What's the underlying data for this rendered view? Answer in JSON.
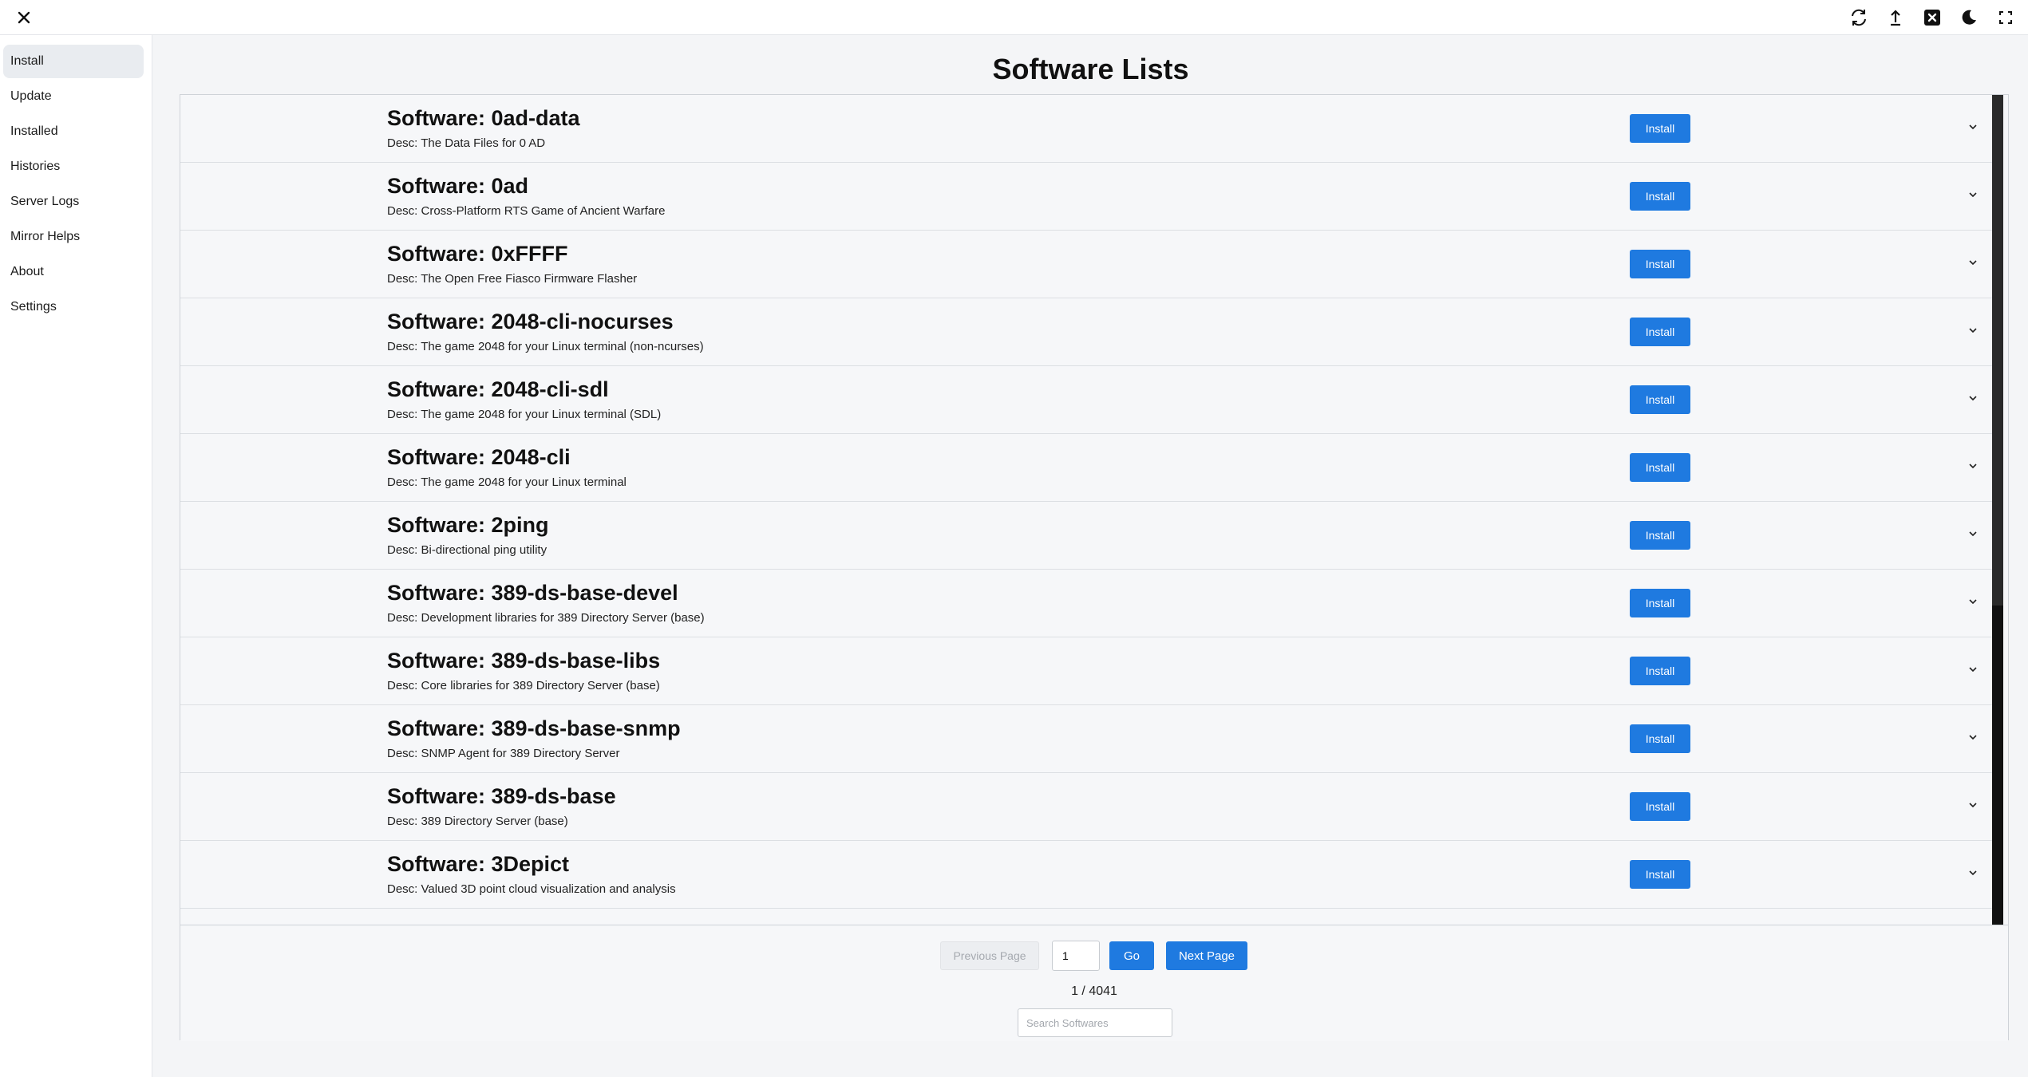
{
  "header": {
    "title": "Software Lists",
    "icons": [
      "close-icon",
      "refresh-icon",
      "upload-icon",
      "close-box-icon",
      "moon-icon",
      "fullscreen-icon"
    ]
  },
  "sidebar": {
    "items": [
      {
        "label": "Install",
        "active": true
      },
      {
        "label": "Update"
      },
      {
        "label": "Installed"
      },
      {
        "label": "Histories"
      },
      {
        "label": "Server Logs"
      },
      {
        "label": "Mirror Helps"
      },
      {
        "label": "About"
      },
      {
        "label": "Settings"
      }
    ]
  },
  "software": [
    {
      "name": "Software: 0ad-data",
      "desc": "Desc: The Data Files for 0 AD",
      "action": "Install"
    },
    {
      "name": "Software: 0ad",
      "desc": "Desc: Cross-Platform RTS Game of Ancient Warfare",
      "action": "Install"
    },
    {
      "name": "Software: 0xFFFF",
      "desc": "Desc: The Open Free Fiasco Firmware Flasher",
      "action": "Install"
    },
    {
      "name": "Software: 2048-cli-nocurses",
      "desc": "Desc: The game 2048 for your Linux terminal (non-ncurses)",
      "action": "Install"
    },
    {
      "name": "Software: 2048-cli-sdl",
      "desc": "Desc: The game 2048 for your Linux terminal (SDL)",
      "action": "Install"
    },
    {
      "name": "Software: 2048-cli",
      "desc": "Desc: The game 2048 for your Linux terminal",
      "action": "Install"
    },
    {
      "name": "Software: 2ping",
      "desc": "Desc: Bi-directional ping utility",
      "action": "Install"
    },
    {
      "name": "Software: 389-ds-base-devel",
      "desc": "Desc: Development libraries for 389 Directory Server (base)",
      "action": "Install"
    },
    {
      "name": "Software: 389-ds-base-libs",
      "desc": "Desc: Core libraries for 389 Directory Server (base)",
      "action": "Install"
    },
    {
      "name": "Software: 389-ds-base-snmp",
      "desc": "Desc: SNMP Agent for 389 Directory Server",
      "action": "Install"
    },
    {
      "name": "Software: 389-ds-base",
      "desc": "Desc: 389 Directory Server (base)",
      "action": "Install"
    },
    {
      "name": "Software: 3Depict",
      "desc": "Desc: Valued 3D point cloud visualization and analysis",
      "action": "Install"
    }
  ],
  "pager": {
    "prev_label": "Previous Page",
    "page_value": "1",
    "go_label": "Go",
    "next_label": "Next Page",
    "page_count": "1 / 4041",
    "search_placeholder": "Search Softwares"
  }
}
